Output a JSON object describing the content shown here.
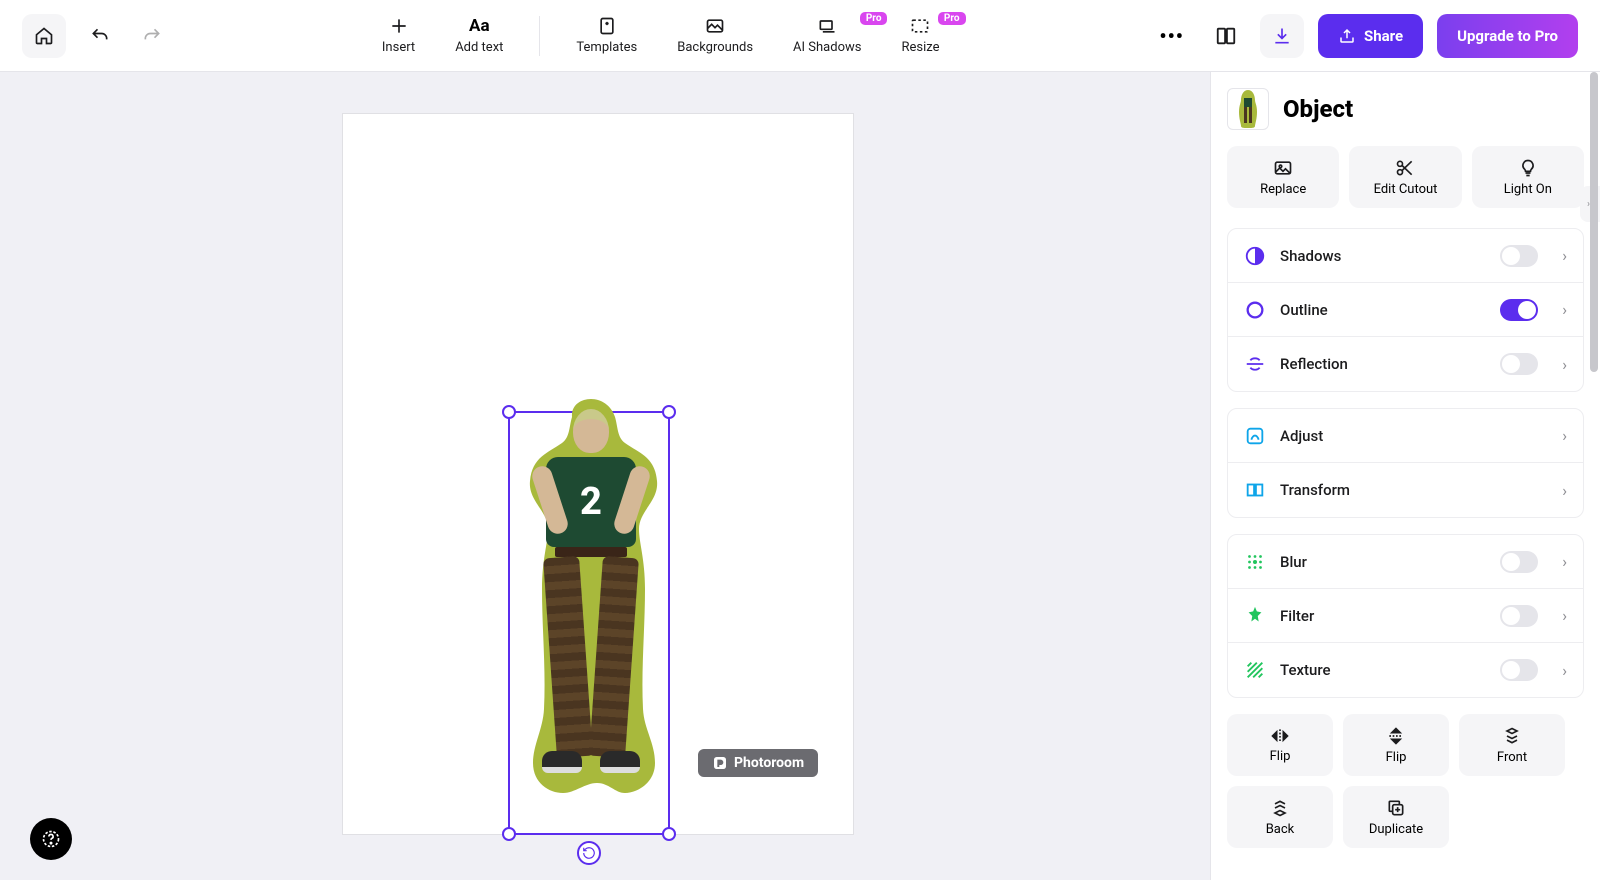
{
  "toolbar": {
    "tools": {
      "insert": "Insert",
      "add_text": "Add text",
      "templates": "Templates",
      "backgrounds": "Backgrounds",
      "ai_shadows": "AI Shadows",
      "resize": "Resize"
    },
    "pro_badge": "Pro",
    "share": "Share",
    "upgrade": "Upgrade to Pro"
  },
  "watermark": "Photoroom",
  "jersey_number": "2",
  "panel": {
    "title": "Object",
    "tiles": {
      "replace": "Replace",
      "edit_cutout": "Edit Cutout",
      "light_on": "Light On"
    },
    "rows": {
      "shadows": {
        "label": "Shadows",
        "on": false
      },
      "outline": {
        "label": "Outline",
        "on": true
      },
      "reflection": {
        "label": "Reflection",
        "on": false
      },
      "adjust": {
        "label": "Adjust"
      },
      "transform": {
        "label": "Transform"
      },
      "blur": {
        "label": "Blur",
        "on": false
      },
      "filter": {
        "label": "Filter",
        "on": false
      },
      "texture": {
        "label": "Texture",
        "on": false
      }
    },
    "actions": {
      "flip_h": "Flip",
      "flip_v": "Flip",
      "front": "Front",
      "back": "Back",
      "duplicate": "Duplicate"
    }
  }
}
